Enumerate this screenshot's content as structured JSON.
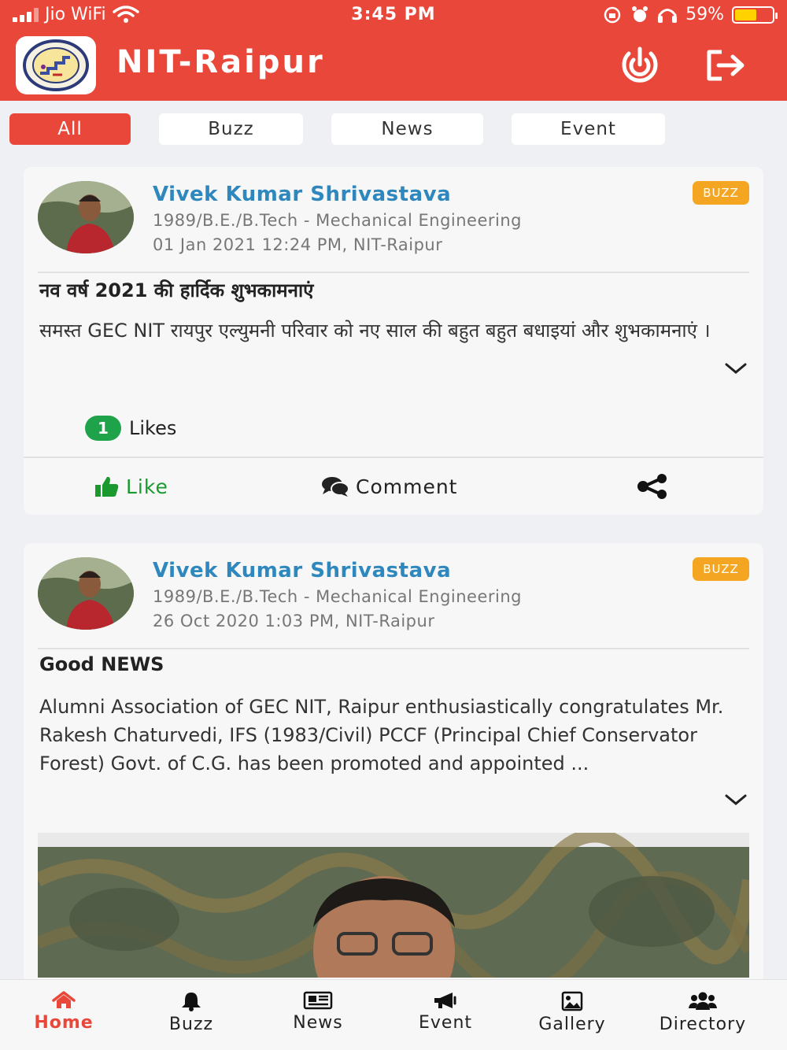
{
  "status_bar": {
    "carrier": "Jio WiFi",
    "time": "3:45 PM",
    "battery": "59%",
    "battery_level": 0.59
  },
  "header": {
    "title": "NIT-Raipur"
  },
  "tabs": [
    {
      "label": "All",
      "active": true
    },
    {
      "label": "Buzz",
      "active": false
    },
    {
      "label": "News",
      "active": false
    },
    {
      "label": "Event",
      "active": false
    }
  ],
  "posts": [
    {
      "author": "Vivek Kumar Shrivastava",
      "details": "1989/B.E./B.Tech - Mechanical Engineering",
      "posted": "01 Jan 2021 12:24 PM, NIT-Raipur",
      "badge": "BUZZ",
      "title": "नव वर्ष 2021 की हार्दिक शुभकामनाएं",
      "body": "समस्त GEC NIT रायपुर एल्युमनी परिवार को नए साल की बहुत बहुत बधाइयां और शुभकामनाएं ।",
      "like_count": "1",
      "likes_label": "Likes",
      "actions": {
        "like": "Like",
        "comment": "Comment"
      }
    },
    {
      "author": "Vivek Kumar Shrivastava",
      "details": "1989/B.E./B.Tech - Mechanical Engineering",
      "posted": "26 Oct 2020 1:03 PM, NIT-Raipur",
      "badge": "BUZZ",
      "title": "Good NEWS",
      "body": "Alumni Association of GEC NIT, Raipur enthusiastically congratulates Mr. Rakesh Chaturvedi, IFS (1983/Civil) PCCF (Principal Chief Conservator Forest) Govt. of C.G. has been promoted and appointed ..."
    }
  ],
  "bottom_nav": [
    {
      "label": "Home",
      "icon": "home-icon",
      "active": true
    },
    {
      "label": "Buzz",
      "icon": "bell-icon",
      "active": false
    },
    {
      "label": "News",
      "icon": "newspaper-icon",
      "active": false
    },
    {
      "label": "Event",
      "icon": "megaphone-icon",
      "active": false
    },
    {
      "label": "Gallery",
      "icon": "image-icon",
      "active": false
    },
    {
      "label": "Directory",
      "icon": "users-icon",
      "active": false
    }
  ],
  "colors": {
    "brand": "#e9473a",
    "author": "#2f88bd",
    "badge": "#f4a623",
    "like": "#1fa34a"
  }
}
